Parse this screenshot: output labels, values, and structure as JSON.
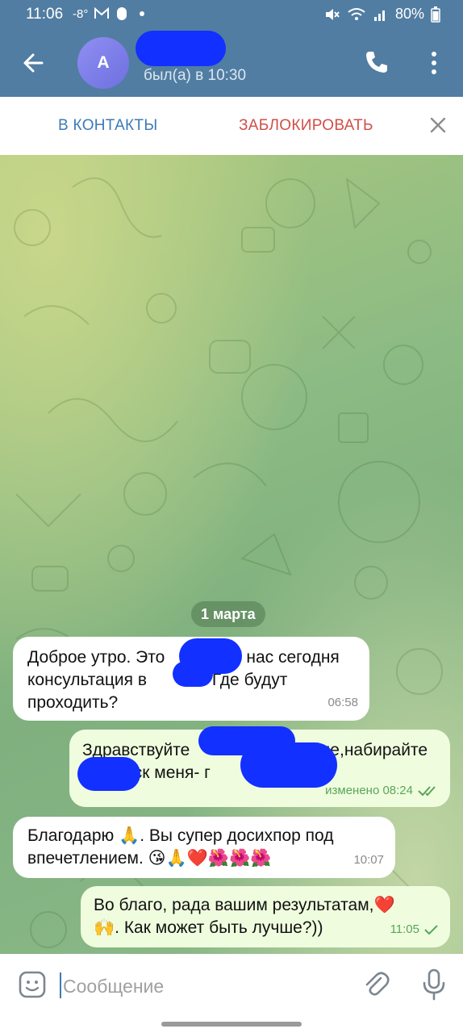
{
  "status_bar": {
    "time": "11:06",
    "temperature": "-8°",
    "battery": "80%"
  },
  "header": {
    "avatar_letter": "A",
    "last_seen": "был(а) в 10:30"
  },
  "action_bar": {
    "add_contact": "В КОНТАКТЫ",
    "block": "ЗАБЛОКИРОВАТЬ"
  },
  "chat": {
    "date_label": "1 марта",
    "messages": [
      {
        "direction": "incoming",
        "text_line1": "Доброе утро. Это ",
        "text_line1b": "У нас сегодня",
        "text_line2": "консультация в ",
        "text_line2b": "00. Где будут",
        "text_line3": "проходить?",
        "time": "06:58"
      },
      {
        "direction": "outgoing",
        "text_line1": "Здравствуйте",
        "text_line1b": "йле,набирайте",
        "text_line2": "иск меня- г",
        "status": "изменено 08:24"
      },
      {
        "direction": "incoming",
        "text_line1": "Благодарю 🙏. Вы супер досихпор под",
        "text_line2": "впечетлением. 😘🙏❤️🌺🌺🌺",
        "time": "10:07"
      },
      {
        "direction": "outgoing",
        "text_line1": "Во благо, рада вашим результатам,❤️",
        "text_line2": "🙌. Как может быть лучше?))",
        "time": "11:05"
      }
    ]
  },
  "input": {
    "placeholder": "Сообщение"
  },
  "colors": {
    "header": "#517da2",
    "accent_blue": "#3c7ab7",
    "block_red": "#d04f49",
    "outgoing_bubble": "#effdde",
    "redaction": "#1230ff"
  }
}
